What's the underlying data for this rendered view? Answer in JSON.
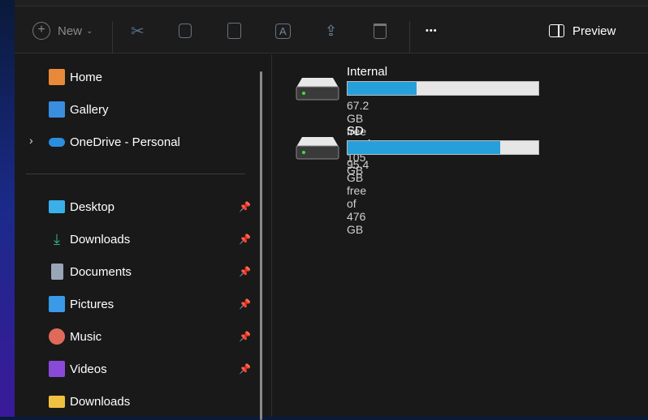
{
  "toolbar": {
    "new_label": "New",
    "preview_label": "Preview",
    "more": "•••"
  },
  "sidebar": {
    "items": [
      {
        "label": "Home",
        "icon": "home-icon",
        "color": "#e8893a"
      },
      {
        "label": "Gallery",
        "icon": "gallery-icon",
        "color": "#3a8ee0"
      },
      {
        "label": "OneDrive - Personal",
        "icon": "onedrive-icon",
        "color": "#2b8fe0"
      },
      {
        "label": "Desktop",
        "icon": "desktop-icon",
        "color": "#3ab0e8",
        "pinned": true
      },
      {
        "label": "Downloads",
        "icon": "download-icon",
        "color": "#2fb884",
        "pinned": true
      },
      {
        "label": "Documents",
        "icon": "documents-icon",
        "color": "#9aa6b8",
        "pinned": true
      },
      {
        "label": "Pictures",
        "icon": "pictures-icon",
        "color": "#3a9ae8",
        "pinned": true
      },
      {
        "label": "Music",
        "icon": "music-icon",
        "color": "#e06a5a",
        "pinned": true
      },
      {
        "label": "Videos",
        "icon": "videos-icon",
        "color": "#8a4ad8",
        "pinned": true
      },
      {
        "label": "Downloads",
        "icon": "folder-icon",
        "color": "#f0c040"
      }
    ]
  },
  "drives": [
    {
      "name": "Internal storage",
      "status": "67.2 GB free of 105 GB",
      "used_percent": 36
    },
    {
      "name": "SD card",
      "status": "95.4 GB free of 476 GB",
      "used_percent": 80
    }
  ]
}
